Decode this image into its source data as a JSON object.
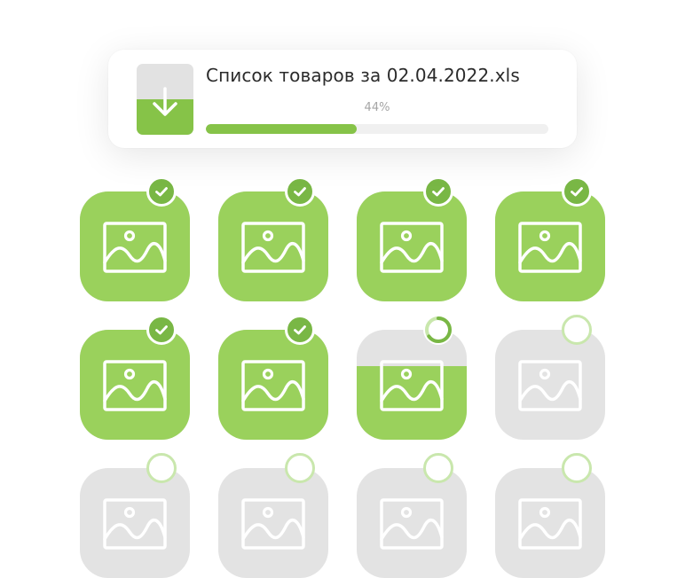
{
  "download": {
    "file_name": "Список товаров за 02.04.2022.xls",
    "percent_label": "44%",
    "progress": 0.44,
    "icon": "download-arrow-icon"
  },
  "colors": {
    "accent": "#86c348",
    "tile_done": "#9ad15c",
    "tile_pending": "#e3e3e3",
    "badge_done": "#79b745",
    "badge_pending_ring": "#c9e7ad"
  },
  "tiles": [
    {
      "status": "done",
      "fill": 1.0,
      "icon": "image-icon"
    },
    {
      "status": "done",
      "fill": 1.0,
      "icon": "image-icon"
    },
    {
      "status": "done",
      "fill": 1.0,
      "icon": "image-icon"
    },
    {
      "status": "done",
      "fill": 1.0,
      "icon": "image-icon"
    },
    {
      "status": "done",
      "fill": 1.0,
      "icon": "image-icon"
    },
    {
      "status": "done",
      "fill": 1.0,
      "icon": "image-icon"
    },
    {
      "status": "in-progress",
      "fill": 0.67,
      "icon": "image-icon"
    },
    {
      "status": "pending",
      "fill": 0,
      "icon": "image-icon"
    },
    {
      "status": "pending",
      "fill": 0,
      "icon": "image-icon"
    },
    {
      "status": "pending",
      "fill": 0,
      "icon": "image-icon"
    },
    {
      "status": "pending",
      "fill": 0,
      "icon": "image-icon"
    },
    {
      "status": "pending",
      "fill": 0,
      "icon": "image-icon"
    }
  ]
}
